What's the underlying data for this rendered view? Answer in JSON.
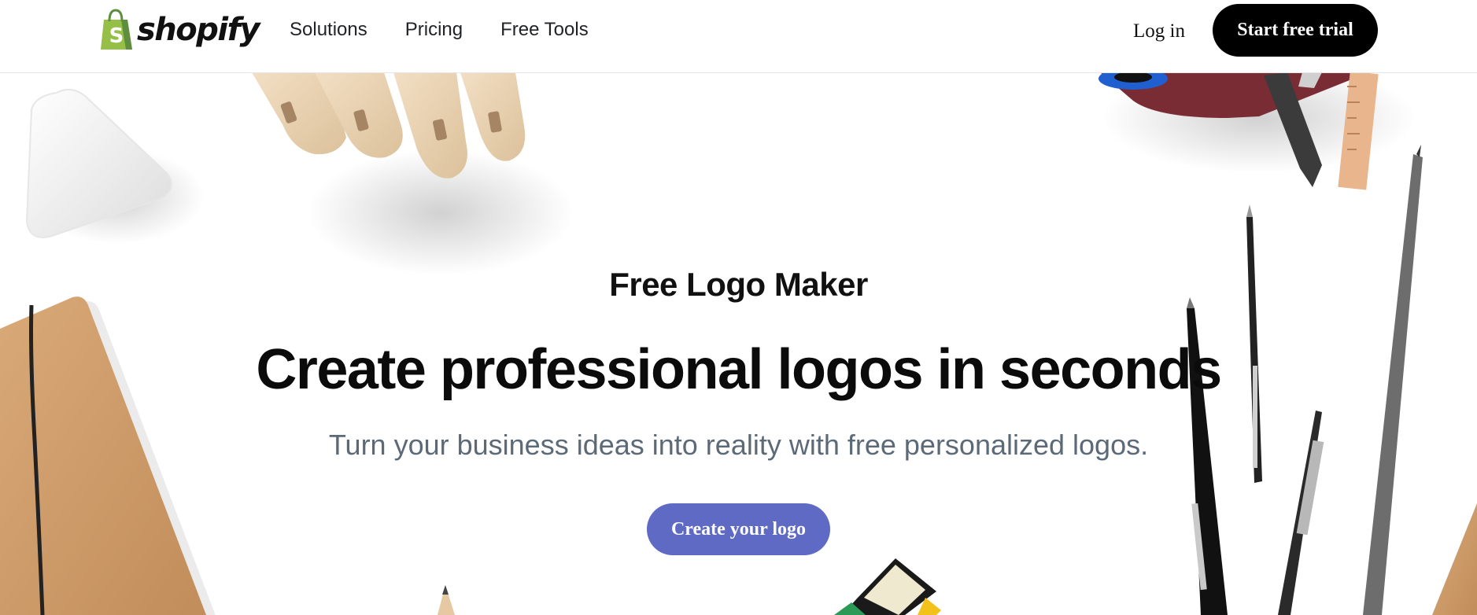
{
  "brand": {
    "name": "shopify",
    "accent": "#95bf47"
  },
  "nav": {
    "items": [
      "Solutions",
      "Pricing",
      "Free Tools"
    ]
  },
  "header": {
    "login_label": "Log in",
    "trial_label": "Start free trial"
  },
  "hero": {
    "kicker": "Free Logo Maker",
    "headline": "Create professional logos in seconds",
    "subheading": "Turn your business ideas into reality with free personalized logos.",
    "cta_label": "Create your logo",
    "cta_color": "#5e6ac4"
  }
}
